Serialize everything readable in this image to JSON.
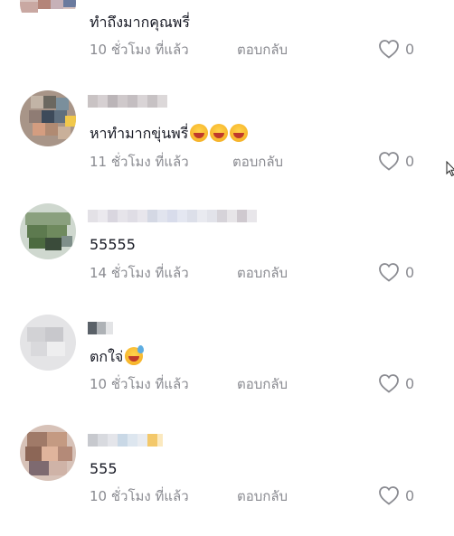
{
  "comments": [
    {
      "text": "ทำถึงมากคุณพรี่",
      "time": "10 ชั่วโมง ที่แล้ว",
      "reply": "ตอบกลับ",
      "likes": "0",
      "emojis": 0
    },
    {
      "text": "หาทำมากขุ่นพรี่",
      "time": "11 ชั่วโมง ที่แล้ว",
      "reply": "ตอบกลับ",
      "likes": "0",
      "emojis": 3
    },
    {
      "text": "55555",
      "time": "14 ชั่วโมง ที่แล้ว",
      "reply": "ตอบกลับ",
      "likes": "0",
      "emojis": 0
    },
    {
      "text": "ตกใจ่",
      "time": "10 ชั่วโมง ที่แล้ว",
      "reply": "ตอบกลับ",
      "likes": "0",
      "emojis": 1
    },
    {
      "text": "555",
      "time": "10 ชั่วโมง ที่แล้ว",
      "reply": "ตอบกลับ",
      "likes": "0",
      "emojis": 0
    }
  ],
  "icons": {
    "like": "heart-outline-icon",
    "emoji_laugh": "laughing-tears-emoji",
    "emoji_sweat": "grinning-sweat-emoji",
    "cursor": "mouse-pointer-icon"
  },
  "colors": {
    "text": "#161823",
    "secondary": "#8a8b91"
  }
}
